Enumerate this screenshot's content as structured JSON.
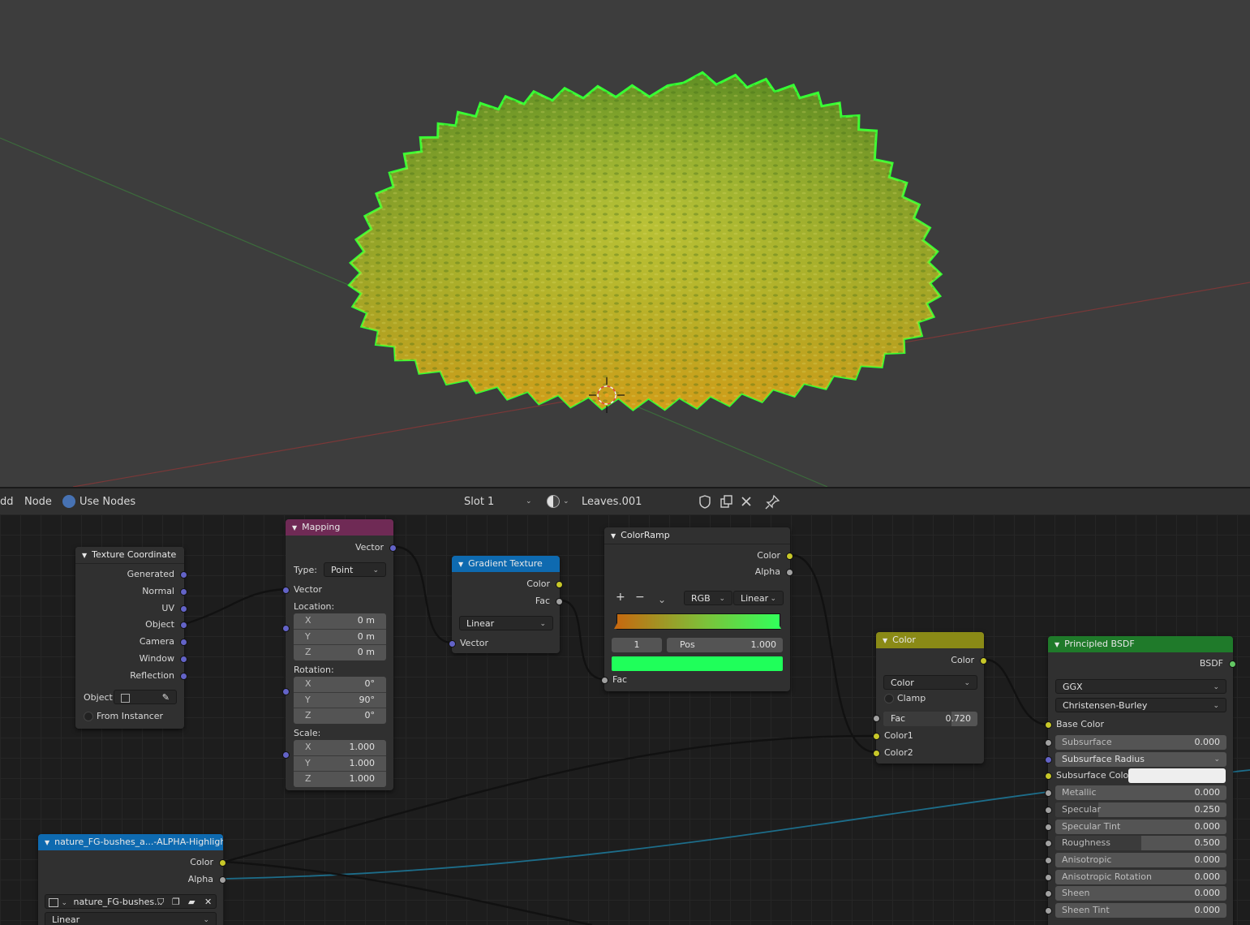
{
  "header": {
    "menu_add": "dd",
    "menu_node": "Node",
    "use_nodes": "Use Nodes",
    "slot": "Slot 1",
    "material": "Leaves.001"
  },
  "nodes": {
    "texcoord": {
      "title": "Texture Coordinate",
      "outputs": [
        "Generated",
        "Normal",
        "UV",
        "Object",
        "Camera",
        "Window",
        "Reflection"
      ],
      "object_label": "Object:",
      "from_instancer": "From Instancer"
    },
    "mapping": {
      "title": "Mapping",
      "out_vector": "Vector",
      "type_label": "Type:",
      "type_value": "Point",
      "in_vector": "Vector",
      "location_label": "Location:",
      "location": [
        {
          "axis": "X",
          "val": "0 m"
        },
        {
          "axis": "Y",
          "val": "0 m"
        },
        {
          "axis": "Z",
          "val": "0 m"
        }
      ],
      "rotation_label": "Rotation:",
      "rotation": [
        {
          "axis": "X",
          "val": "0°"
        },
        {
          "axis": "Y",
          "val": "90°"
        },
        {
          "axis": "Z",
          "val": "0°"
        }
      ],
      "scale_label": "Scale:",
      "scale": [
        {
          "axis": "X",
          "val": "1.000"
        },
        {
          "axis": "Y",
          "val": "1.000"
        },
        {
          "axis": "Z",
          "val": "1.000"
        }
      ]
    },
    "gradient": {
      "title": "Gradient Texture",
      "out_color": "Color",
      "out_fac": "Fac",
      "type_value": "Linear",
      "in_vector": "Vector"
    },
    "colorramp": {
      "title": "ColorRamp",
      "out_color": "Color",
      "out_alpha": "Alpha",
      "plus": "+",
      "minus": "−",
      "mode": "RGB",
      "interp": "Linear",
      "stop_index": "1",
      "pos_label": "Pos",
      "pos_value": "1.000",
      "in_fac": "Fac",
      "stop_color": "#1fff5a"
    },
    "mix": {
      "title": "Color",
      "out_color": "Color",
      "blend": "Color",
      "clamp": "Clamp",
      "fac_label": "Fac",
      "fac_value": "0.720",
      "fac_level": 0.72,
      "in_color1": "Color1",
      "in_color2": "Color2"
    },
    "image": {
      "title": "nature_FG-bushes_a...-ALPHA-Highlights.png",
      "out_color": "Color",
      "out_alpha": "Alpha",
      "file": "nature_FG-bushes...",
      "interp": "Linear"
    },
    "bsdf": {
      "title": "Principled BSDF",
      "out": "BSDF",
      "dist": "GGX",
      "sss": "Christensen-Burley",
      "base_color": "Base Color",
      "subsurface_color": "Subsurface Colo",
      "subsurface_radius": "Subsurface Radius",
      "props": [
        {
          "label": "Subsurface",
          "val": "0.000",
          "level": 0.0
        },
        {
          "label": "Metallic",
          "val": "0.000",
          "level": 0.0
        },
        {
          "label": "Specular",
          "val": "0.250",
          "level": 0.25
        },
        {
          "label": "Specular Tint",
          "val": "0.000",
          "level": 0.0
        },
        {
          "label": "Roughness",
          "val": "0.500",
          "level": 0.5
        },
        {
          "label": "Anisotropic",
          "val": "0.000",
          "level": 0.0
        },
        {
          "label": "Anisotropic Rotation",
          "val": "0.000",
          "level": 0.0
        },
        {
          "label": "Sheen",
          "val": "0.000",
          "level": 0.0
        },
        {
          "label": "Sheen Tint",
          "val": "0.000",
          "level": 0.0
        }
      ]
    }
  },
  "colors": {
    "outline": "#33ff33",
    "mapping_header": "#6f2a55",
    "gradient_header": "#0e6ab0",
    "mix_header": "#8a8a16",
    "bsdf_header": "#1f7a2a",
    "image_header": "#0e6ab0"
  }
}
